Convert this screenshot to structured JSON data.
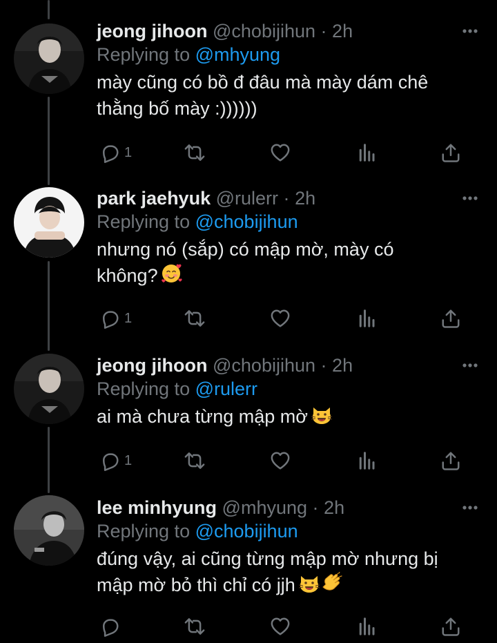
{
  "colors": {
    "background": "#000000",
    "text": "#e7e9ea",
    "secondary": "#71767b",
    "link": "#1d9bf0",
    "thread_line": "#3e4144"
  },
  "icons": {
    "reply": "reply-icon",
    "retweet": "retweet-icon",
    "like": "like-icon",
    "views": "views-icon",
    "share": "share-icon",
    "more": "more-icon"
  },
  "reply_prefix": "Replying to",
  "tweets": [
    {
      "name": "jeong jihoon",
      "handle": "@chobijihun",
      "separator": "·",
      "time": "2h",
      "replying_to": "@mhyung",
      "text": "mày cũng có bồ đ đâu mà mày dám chê\nthằng bố mày :))))))",
      "emoji": [],
      "reply_count": "1"
    },
    {
      "name": "park jaehyuk",
      "handle": "@rulerr",
      "separator": "·",
      "time": "2h",
      "replying_to": "@chobijihun",
      "text": "nhưng nó (sắp) có mập mờ, mày có\nkhông?",
      "emoji": [
        "smiling-face-with-hearts"
      ],
      "reply_count": "1"
    },
    {
      "name": "jeong jihoon",
      "handle": "@chobijihun",
      "separator": "·",
      "time": "2h",
      "replying_to": "@rulerr",
      "text": "ai mà chưa từng mập mờ",
      "emoji": [
        "grinning-cat"
      ],
      "reply_count": "1"
    },
    {
      "name": "lee minhyung",
      "handle": "@mhyung",
      "separator": "·",
      "time": "2h",
      "replying_to": "@chobijihun",
      "text": "đúng vậy, ai cũng từng mập mờ nhưng bị\nmập mờ bỏ thì chỉ có jjh",
      "emoji": [
        "grinning-cat",
        "clapping-hands"
      ],
      "reply_count": ""
    }
  ]
}
